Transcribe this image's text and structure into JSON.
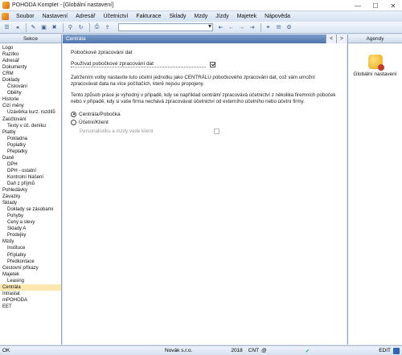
{
  "window": {
    "title": "POHODA Komplet - [Globální nastavení]",
    "controls": [
      "—",
      "☐",
      "✕"
    ]
  },
  "menu": [
    {
      "label": "Soubor"
    },
    {
      "label": "Nastavení"
    },
    {
      "label": "Adresář"
    },
    {
      "label": "Účetnictví"
    },
    {
      "label": "Fakturace"
    },
    {
      "label": "Sklady"
    },
    {
      "label": "Mzdy"
    },
    {
      "label": "Jízdy"
    },
    {
      "label": "Majetek"
    },
    {
      "label": "Nápověda"
    }
  ],
  "sidebar": {
    "title": "Sekce",
    "items": [
      {
        "label": "Logo",
        "level": 0
      },
      {
        "label": "Razítko",
        "level": 0
      },
      {
        "label": "Adresář",
        "level": 0
      },
      {
        "label": "Dokumenty",
        "level": 0
      },
      {
        "label": "CRM",
        "level": 0
      },
      {
        "label": "Doklady",
        "level": 0
      },
      {
        "label": "Číslování",
        "level": 1
      },
      {
        "label": "Oběhy",
        "level": 1
      },
      {
        "label": "Historie",
        "level": 0
      },
      {
        "label": "Cizí měny",
        "level": 0
      },
      {
        "label": "Uzávěrka kurz. rozdílů",
        "level": 1
      },
      {
        "label": "Zaúčtování",
        "level": 0
      },
      {
        "label": "Texty v úč. deníku",
        "level": 1
      },
      {
        "label": "Platby",
        "level": 0
      },
      {
        "label": "Pokladna",
        "level": 1
      },
      {
        "label": "Poplatky",
        "level": 1
      },
      {
        "label": "Přeplatky",
        "level": 1
      },
      {
        "label": "Daně",
        "level": 0
      },
      {
        "label": "DPH",
        "level": 1
      },
      {
        "label": "DPH - ostatní",
        "level": 1
      },
      {
        "label": "Kontrolní hlášení",
        "level": 1
      },
      {
        "label": "Daň z příjmů",
        "level": 1
      },
      {
        "label": "Pohledávky",
        "level": 0
      },
      {
        "label": "Závazky",
        "level": 0
      },
      {
        "label": "Sklady",
        "level": 0
      },
      {
        "label": "Doklady se zásobami",
        "level": 1
      },
      {
        "label": "Pohyby",
        "level": 1
      },
      {
        "label": "Ceny a slevy",
        "level": 1
      },
      {
        "label": "Sklady A",
        "level": 1
      },
      {
        "label": "Prodejky",
        "level": 1
      },
      {
        "label": "Mzdy",
        "level": 0
      },
      {
        "label": "Instituce",
        "level": 1
      },
      {
        "label": "Příplatky",
        "level": 1
      },
      {
        "label": "Předkontace",
        "level": 1
      },
      {
        "label": "Cestovní příkazy",
        "level": 0
      },
      {
        "label": "Majetek",
        "level": 0
      },
      {
        "label": "Leasing",
        "level": 1
      },
      {
        "label": "Centrála",
        "level": 0,
        "active": true
      },
      {
        "label": "Intrastat",
        "level": 0
      },
      {
        "label": "mPOHODA",
        "level": 0
      },
      {
        "label": "EET",
        "level": 0
      }
    ]
  },
  "main": {
    "tab_label": "Centrála",
    "nav_prev": "<",
    "nav_next": ">",
    "section_title": "Pobočkové zpracování dat",
    "use_branch_label": "Používat pobočkové zpracování dat",
    "use_branch_checked": true,
    "para1": "Zatržením volby nastavíte tuto účetní jednotku jako CENTRÁLU pobočkového zpracování dat, což vám umožní zpracovávat data na více počítačích, které nejsou propojeny.",
    "para2": "Tento způsob práce je výhodný v případě, kdy se například centrální zpracovává účetnictví z několika firemních poboček nebo v případě, kdy si vaše firma nechává zpracovávat účetnictví od externího účetního nebo účetní firmy.",
    "radio1_label": "Centrála/Pobočka",
    "radio1_selected": true,
    "radio2_label": "Účetní/Klient",
    "radio2_selected": false,
    "sub_option_label": "Personalistiku a mzdy vede klient",
    "sub_option_checked": false
  },
  "agenda": {
    "title": "Agendy",
    "item_label": "Globální nastavení"
  },
  "status": {
    "left": "OK",
    "company": "Novák s.r.o.",
    "year": "2018",
    "cnt": "CNT",
    "at": "@",
    "edit": "EDIT"
  }
}
